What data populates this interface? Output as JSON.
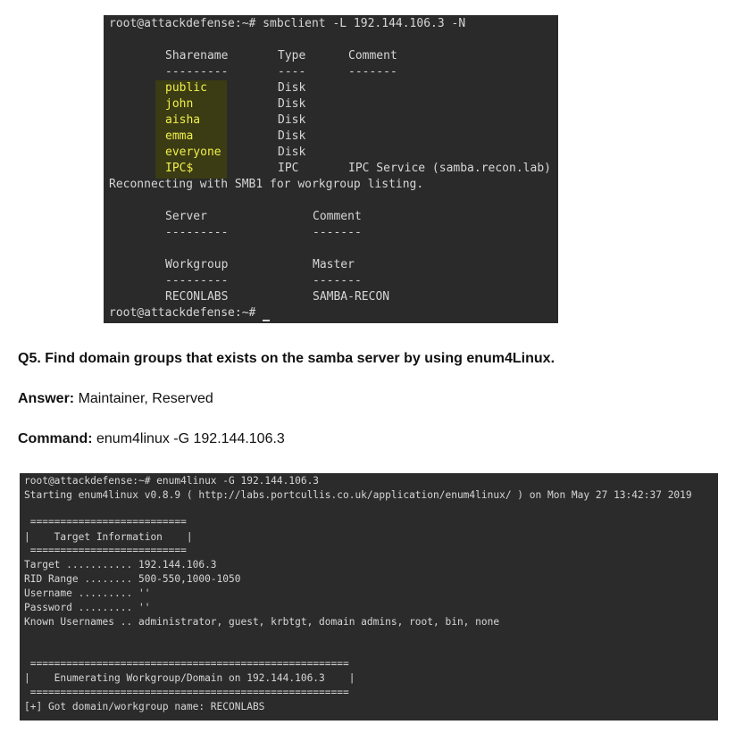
{
  "terminal1": {
    "prompt_cmd": "root@attackdefense:~# smbclient -L 192.144.106.3 -N",
    "hdr_share": "Sharename",
    "hdr_type": "Type",
    "hdr_comment": "Comment",
    "dash_share": "---------",
    "dash_type": "----",
    "dash_comment": "-------",
    "shares": [
      {
        "name": "public",
        "type": "Disk",
        "comment": ""
      },
      {
        "name": "john",
        "type": "Disk",
        "comment": ""
      },
      {
        "name": "aisha",
        "type": "Disk",
        "comment": ""
      },
      {
        "name": "emma",
        "type": "Disk",
        "comment": ""
      },
      {
        "name": "everyone",
        "type": "Disk",
        "comment": ""
      },
      {
        "name": "IPC$",
        "type": "IPC",
        "comment": "IPC Service (samba.recon.lab)"
      }
    ],
    "reconnect": "Reconnecting with SMB1 for workgroup listing.",
    "hdr_server": "Server",
    "hdr_server_comment": "Comment",
    "dash_server": "---------",
    "dash_server_comment": "-------",
    "hdr_workgroup": "Workgroup",
    "hdr_master": "Master",
    "dash_workgroup": "---------",
    "dash_master": "-------",
    "workgroup": "RECONLABS",
    "master": "SAMBA-RECON",
    "final_prompt": "root@attackdefense:~#"
  },
  "question": {
    "q": "Q5. Find domain groups that exists on the samba server by using enum4Linux.",
    "answer_label": "Answer:",
    "answer_value": " Maintainer, Reserved",
    "command_label": "Command:",
    "command_value": " enum4linux -G 192.144.106.3"
  },
  "terminal2": {
    "lines": [
      "root@attackdefense:~# enum4linux -G 192.144.106.3",
      "Starting enum4linux v0.8.9 ( http://labs.portcullis.co.uk/application/enum4linux/ ) on Mon May 27 13:42:37 2019",
      "",
      " ==========================",
      "|    Target Information    |",
      " ==========================",
      "Target ........... 192.144.106.3",
      "RID Range ........ 500-550,1000-1050",
      "Username ......... ''",
      "Password ......... ''",
      "Known Usernames .. administrator, guest, krbtgt, domain admins, root, bin, none",
      "",
      "",
      " =====================================================",
      "|    Enumerating Workgroup/Domain on 192.144.106.3    |",
      " =====================================================",
      "[+] Got domain/workgroup name: RECONLABS"
    ]
  }
}
